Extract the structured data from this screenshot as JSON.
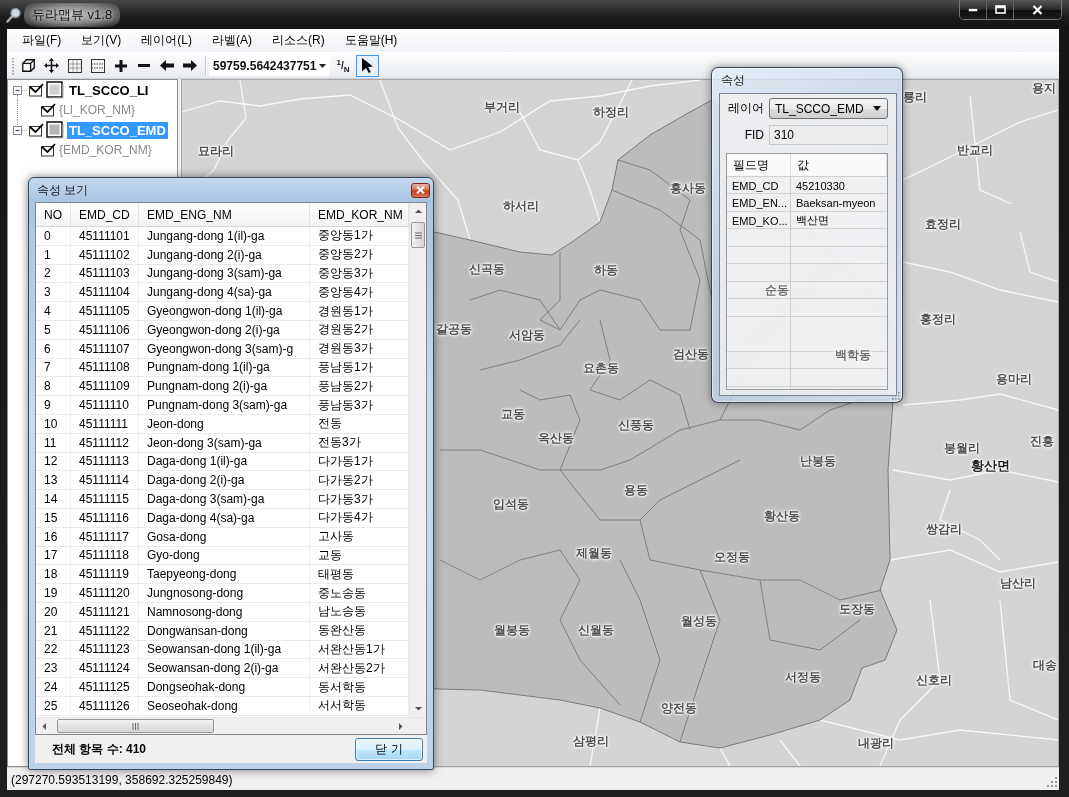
{
  "window": {
    "title": "듀라맵뷰 v1.8"
  },
  "menu": [
    "파일(F)",
    "보기(V)",
    "레이어(L)",
    "라벨(A)",
    "리소스(R)",
    "도움말(H)"
  ],
  "toolbar": {
    "tools": [
      {
        "kind": "cube",
        "selected": false
      },
      {
        "kind": "move",
        "selected": false
      },
      {
        "kind": "grid",
        "selected": false
      },
      {
        "kind": "rows",
        "selected": false
      },
      {
        "kind": "plus",
        "selected": false
      },
      {
        "kind": "minus",
        "selected": false
      },
      {
        "kind": "back",
        "selected": false
      },
      {
        "kind": "forward",
        "selected": false
      }
    ],
    "scale": "59759.5642437751",
    "ratio_button": "$^{1}$/$_{N}$",
    "pointer_tool": {
      "selected": true
    }
  },
  "layers": [
    {
      "name": "TL_SCCO_LI",
      "expanded": true,
      "visible": true,
      "selected": false,
      "color": "#d0d0d0",
      "children": [
        {
          "name": "{LI_KOR_NM}",
          "visible": true
        }
      ]
    },
    {
      "name": "TL_SCCO_EMD",
      "expanded": true,
      "visible": true,
      "selected": true,
      "color": "#b4b4b4",
      "children": [
        {
          "name": "{EMD_KOR_NM}",
          "visible": true
        }
      ]
    }
  ],
  "map": {
    "labels": [
      {
        "text": "룡리",
        "kind": "place"
      },
      {
        "text": "용지",
        "kind": "place"
      },
      {
        "text": "부거리",
        "kind": "place"
      },
      {
        "text": "하정리",
        "kind": "place"
      },
      {
        "text": "묘라리",
        "kind": "place"
      },
      {
        "text": "반교리",
        "kind": "place"
      },
      {
        "text": "흥사동",
        "kind": "place"
      },
      {
        "text": "하서리",
        "kind": "place"
      },
      {
        "text": "효정리",
        "kind": "place"
      },
      {
        "text": "신곡동",
        "kind": "place"
      },
      {
        "text": "하동",
        "kind": "place"
      },
      {
        "text": "순동",
        "kind": "faded"
      },
      {
        "text": "홍정리",
        "kind": "place"
      },
      {
        "text": "갈공동",
        "kind": "place"
      },
      {
        "text": "서암동",
        "kind": "place"
      },
      {
        "text": "검산동",
        "kind": "place"
      },
      {
        "text": "백학동",
        "kind": "faded"
      },
      {
        "text": "요촌동",
        "kind": "place"
      },
      {
        "text": "용마리",
        "kind": "place"
      },
      {
        "text": "교동",
        "kind": "place"
      },
      {
        "text": "신풍동",
        "kind": "place"
      },
      {
        "text": "옥산동",
        "kind": "place"
      },
      {
        "text": "진흥",
        "kind": "place"
      },
      {
        "text": "봉월리",
        "kind": "place"
      },
      {
        "text": "난봉동",
        "kind": "place"
      },
      {
        "text": "황산면",
        "kind": "town"
      },
      {
        "text": "용동",
        "kind": "place"
      },
      {
        "text": "입석동",
        "kind": "place"
      },
      {
        "text": "황산동",
        "kind": "place"
      },
      {
        "text": "쌍감리",
        "kind": "place"
      },
      {
        "text": "제월동",
        "kind": "place"
      },
      {
        "text": "오정동",
        "kind": "place"
      },
      {
        "text": "남산리",
        "kind": "place"
      },
      {
        "text": "도장동",
        "kind": "place"
      },
      {
        "text": "월성동",
        "kind": "place"
      },
      {
        "text": "월봉동",
        "kind": "place"
      },
      {
        "text": "신월동",
        "kind": "place"
      },
      {
        "text": "대송",
        "kind": "place"
      },
      {
        "text": "서정동",
        "kind": "place"
      },
      {
        "text": "신호리",
        "kind": "place"
      },
      {
        "text": "양전동",
        "kind": "place"
      },
      {
        "text": "삼평리",
        "kind": "place"
      },
      {
        "text": "내광리",
        "kind": "place"
      }
    ]
  },
  "attribute_window": {
    "title": "속성 보기",
    "columns": [
      "NO",
      "EMD_CD",
      "EMD_ENG_NM",
      "EMD_KOR_NM"
    ],
    "rows": [
      [
        "0",
        "45111101",
        "Jungang-dong 1(il)-ga",
        "중앙동1가"
      ],
      [
        "1",
        "45111102",
        "Jungang-dong 2(i)-ga",
        "중앙동2가"
      ],
      [
        "2",
        "45111103",
        "Jungang-dong 3(sam)-ga",
        "중앙동3가"
      ],
      [
        "3",
        "45111104",
        "Jungang-dong 4(sa)-ga",
        "중앙동4가"
      ],
      [
        "4",
        "45111105",
        "Gyeongwon-dong 1(il)-ga",
        "경원동1가"
      ],
      [
        "5",
        "45111106",
        "Gyeongwon-dong 2(i)-ga",
        "경원동2가"
      ],
      [
        "6",
        "45111107",
        "Gyeongwon-dong 3(sam)-g",
        "경원동3가"
      ],
      [
        "7",
        "45111108",
        "Pungnam-dong 1(il)-ga",
        "풍남동1가"
      ],
      [
        "8",
        "45111109",
        "Pungnam-dong 2(i)-ga",
        "풍남동2가"
      ],
      [
        "9",
        "45111110",
        "Pungnam-dong 3(sam)-ga",
        "풍남동3가"
      ],
      [
        "10",
        "45111111",
        "Jeon-dong",
        "전동"
      ],
      [
        "11",
        "45111112",
        "Jeon-dong 3(sam)-ga",
        "전동3가"
      ],
      [
        "12",
        "45111113",
        "Daga-dong 1(il)-ga",
        "다가동1가"
      ],
      [
        "13",
        "45111114",
        "Daga-dong 2(i)-ga",
        "다가동2가"
      ],
      [
        "14",
        "45111115",
        "Daga-dong 3(sam)-ga",
        "다가동3가"
      ],
      [
        "15",
        "45111116",
        "Daga-dong 4(sa)-ga",
        "다가동4가"
      ],
      [
        "16",
        "45111117",
        "Gosa-dong",
        "고사동"
      ],
      [
        "17",
        "45111118",
        "Gyo-dong",
        "교동"
      ],
      [
        "18",
        "45111119",
        "Taepyeong-dong",
        "태평동"
      ],
      [
        "19",
        "45111120",
        "Jungnosong-dong",
        "중노송동"
      ],
      [
        "20",
        "45111121",
        "Namnosong-dong",
        "남노송동"
      ],
      [
        "21",
        "45111122",
        "Dongwansan-dong",
        "동완산동"
      ],
      [
        "22",
        "45111123",
        "Seowansan-dong 1(il)-ga",
        "서완산동1가"
      ],
      [
        "23",
        "45111124",
        "Seowansan-dong 2(i)-ga",
        "서완산동2가"
      ],
      [
        "24",
        "45111125",
        "Dongseohak-dong",
        "동서학동"
      ],
      [
        "25",
        "45111126",
        "Seoseohak-dong",
        "서서학동"
      ]
    ],
    "total": "전체 항목 수: 410",
    "close_button": "닫 기"
  },
  "properties_panel": {
    "title": "속성",
    "layer_label": "레이어",
    "layer_value": "TL_SCCO_EMD",
    "fid_label": "FID",
    "fid_value": "310",
    "columns": [
      "필드명",
      "값"
    ],
    "rows": [
      [
        "EMD_CD",
        "45210330"
      ],
      [
        "EMD_EN...",
        "Baeksan-myeon"
      ],
      [
        "EMD_KO...",
        "백산면"
      ]
    ]
  },
  "status_bar": {
    "coordinates": "(297270.593513199, 358692.325259849)"
  }
}
